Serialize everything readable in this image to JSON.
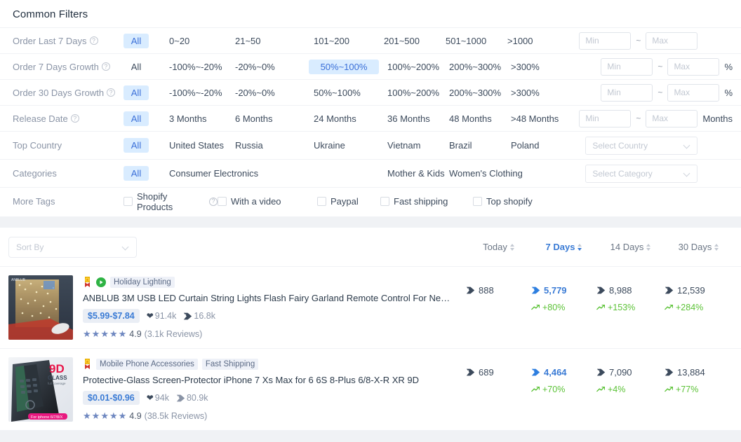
{
  "panel": {
    "title": "Common Filters"
  },
  "filters": [
    {
      "label": "Order Last 7 Days",
      "help": "?",
      "options": [
        "All",
        "0~20",
        "21~50",
        "101~200",
        "201~500",
        "501~1000",
        ">1000"
      ],
      "selected": "All",
      "min_placeholder": "Min",
      "max_placeholder": "Max",
      "tilde": "~",
      "unit": ""
    },
    {
      "label": "Order 7 Days Growth",
      "help": "?",
      "options": [
        "All",
        "-100%~-20%",
        "-20%~0%",
        "50%~100%",
        "100%~200%",
        "200%~300%",
        ">300%"
      ],
      "selected": "50%~100%",
      "min_placeholder": "Min",
      "max_placeholder": "Max",
      "tilde": "~",
      "unit": "%"
    },
    {
      "label": "Order 30 Days Growth",
      "help": "?",
      "options": [
        "All",
        "-100%~-20%",
        "-20%~0%",
        "50%~100%",
        "100%~200%",
        "200%~300%",
        ">300%"
      ],
      "selected": "All",
      "min_placeholder": "Min",
      "max_placeholder": "Max",
      "tilde": "~",
      "unit": "%"
    },
    {
      "label": "Release Date",
      "help": "?",
      "options": [
        "All",
        "3 Months",
        "6 Months",
        "24 Months",
        "36 Months",
        "48 Months",
        ">48 Months"
      ],
      "selected": "All",
      "min_placeholder": "Min",
      "max_placeholder": "Max",
      "tilde": "~",
      "unit": "Months"
    }
  ],
  "country_row": {
    "label": "Top Country",
    "options": [
      "All",
      "United States",
      "Russia",
      "Ukraine",
      "Vietnam",
      "Brazil",
      "Poland"
    ],
    "selected": "All",
    "select_placeholder": "Select Country"
  },
  "category_row": {
    "label": "Categories",
    "options": [
      "All",
      "Consumer Electronics",
      "",
      "Mother & Kids",
      "Women's Clothing"
    ],
    "selected": "All",
    "select_placeholder": "Select Category"
  },
  "more_tags": {
    "label": "More Tags",
    "items": [
      {
        "label": "Shopify Products",
        "help": "?",
        "checked": false
      },
      {
        "label": "With a video",
        "checked": false
      },
      {
        "label": "Paypal",
        "checked": false
      },
      {
        "label": "Fast shipping",
        "checked": false
      },
      {
        "label": "Top shopify",
        "checked": false
      }
    ]
  },
  "sort": {
    "placeholder": "Sort By"
  },
  "columns": [
    {
      "label": "Today",
      "active": false
    },
    {
      "label": "7 Days",
      "active": true
    },
    {
      "label": "14 Days",
      "active": false
    },
    {
      "label": "30 Days",
      "active": false
    }
  ],
  "products": [
    {
      "badges": [
        "medal-icon",
        "video-play-icon"
      ],
      "tags": [
        "Holiday Lighting"
      ],
      "title": "ANBLUB 3M USB LED Curtain String Lights Flash Fairy Garland Remote Control For New...",
      "price": "$5.99-$7.84",
      "likes": "91.4k",
      "orders": "16.8k",
      "rating": "4.9",
      "reviews": "(3.1k Reviews)",
      "stars": 5,
      "metrics": [
        {
          "value": "888",
          "growth": ""
        },
        {
          "value": "5,779",
          "growth": "+80%"
        },
        {
          "value": "8,988",
          "growth": "+153%"
        },
        {
          "value": "12,539",
          "growth": "+284%"
        }
      ]
    },
    {
      "badges": [
        "medal-icon"
      ],
      "tags": [
        "Mobile Phone Accessories",
        "Fast Shipping"
      ],
      "title": "Protective-Glass Screen-Protector iPhone 7 Xs Max for 6 6S 8-Plus 6/8-X-R XR 9D",
      "price": "$0.01-$0.96",
      "likes": "94k",
      "orders": "80.9k",
      "rating": "4.9",
      "reviews": "(38.5k Reviews)",
      "stars": 5,
      "metrics": [
        {
          "value": "689",
          "growth": ""
        },
        {
          "value": "4,464",
          "growth": "+70%"
        },
        {
          "value": "7,090",
          "growth": "+4%"
        },
        {
          "value": "13,884",
          "growth": "+77%"
        }
      ]
    }
  ],
  "colors": {
    "accent": "#3a7bd5",
    "chip_selected_bg": "#d9ecff",
    "growth_green": "#5bc236",
    "page_bg": "#f0f2f5"
  }
}
